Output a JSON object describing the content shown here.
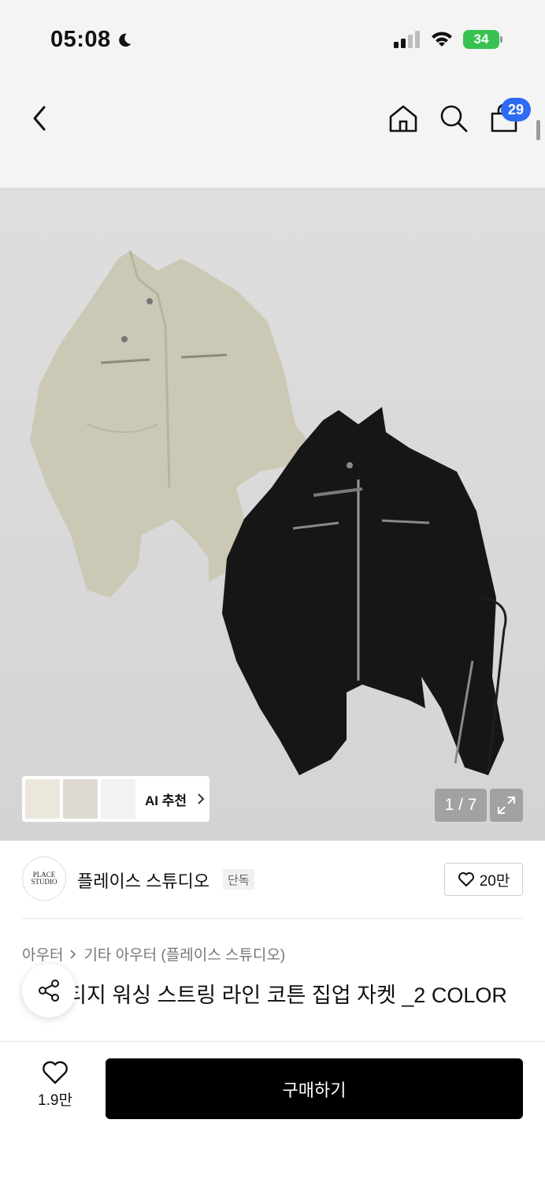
{
  "status_bar": {
    "time": "05:08",
    "battery": "34"
  },
  "header": {
    "cart_count": "29"
  },
  "gallery": {
    "ai_label": "AI 추천",
    "page_indicator": "1 / 7"
  },
  "brand": {
    "logo_text": "PLACE STUDIO",
    "name": "플레이스 스튜디오",
    "tag": "단독",
    "like_count": "20만"
  },
  "breadcrumb": {
    "category": "아우터",
    "subcategory": "기타 아우터 (플레이스 스튜디오)"
  },
  "product": {
    "title": "지 빈티지 워싱 스트링 라인 코튼 집업 자켓 _2 COLOR"
  },
  "bottom_bar": {
    "wish_count": "1.9만",
    "buy_label": "구매하기"
  },
  "colors": {
    "accent": "#2f6bf2",
    "battery": "#39c252",
    "buy_button": "#000000"
  }
}
